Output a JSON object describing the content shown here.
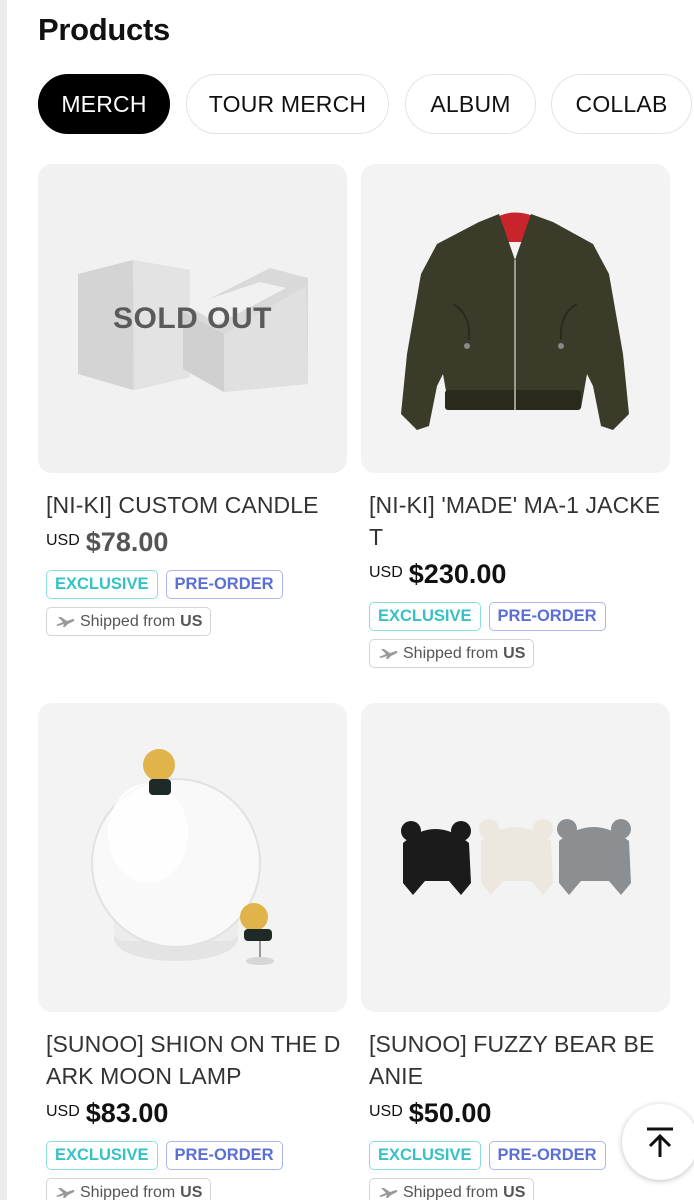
{
  "page": {
    "title": "Products"
  },
  "tabs": [
    {
      "label": "MERCH",
      "active": true
    },
    {
      "label": "TOUR MERCH",
      "active": false
    },
    {
      "label": "ALBUM",
      "active": false
    },
    {
      "label": "COLLAB",
      "active": false
    }
  ],
  "products": [
    {
      "name": "[NI-KI] CUSTOM CANDLE",
      "currency": "USD",
      "price": "$78.00",
      "sold_out_label": "SOLD OUT",
      "badges": [
        "EXCLUSIVE",
        "PRE-ORDER"
      ],
      "shipping": {
        "prefix": "Shipped from",
        "country": "US"
      }
    },
    {
      "name": "[NI-KI] 'MADE' MA-1 JACKET",
      "currency": "USD",
      "price": "$230.00",
      "badges": [
        "EXCLUSIVE",
        "PRE-ORDER"
      ],
      "shipping": {
        "prefix": "Shipped from",
        "country": "US"
      }
    },
    {
      "name": "[SUNOO] SHION ON THE DARK MOON LAMP",
      "currency": "USD",
      "price": "$83.00",
      "badges": [
        "EXCLUSIVE",
        "PRE-ORDER"
      ],
      "shipping": {
        "prefix": "Shipped from",
        "country": "US"
      }
    },
    {
      "name": "[SUNOO] FUZZY BEAR BEANIE",
      "currency": "USD",
      "price": "$50.00",
      "badges": [
        "EXCLUSIVE",
        "PRE-ORDER"
      ],
      "shipping": {
        "prefix": "Shipped from",
        "country": "US"
      }
    }
  ],
  "icons": {
    "scroll_top": "arrow-up-to-line-icon",
    "plane": "plane-icon"
  },
  "colors": {
    "exclusive": "#35c2c6",
    "preorder": "#5b6fd6",
    "active_tab": "#000000"
  }
}
